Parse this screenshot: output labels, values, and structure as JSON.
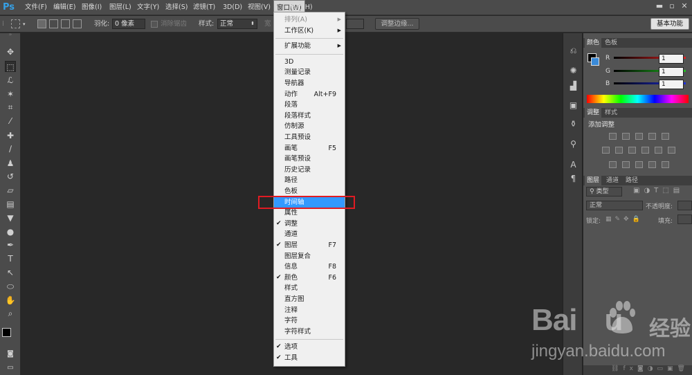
{
  "app": {
    "logo": "Ps"
  },
  "menubar": {
    "items": [
      "文件(F)",
      "编辑(E)",
      "图像(I)",
      "图层(L)",
      "文字(Y)",
      "选择(S)",
      "滤镜(T)",
      "3D(D)",
      "视图(V)",
      "窗口(W)",
      "帮助(H)"
    ],
    "active_index": 9
  },
  "options": {
    "feather_label": "羽化:",
    "feather_value": "0 像素",
    "antialias_label": "消除锯齿",
    "style_label": "样式:",
    "style_value": "正常",
    "width_label": "宽",
    "refine_edge": "调整边缘...",
    "workspace": "基本功能"
  },
  "toolbar": {
    "tools": [
      "move-icon",
      "rect-marquee-icon",
      "lasso-icon",
      "quick-select-icon",
      "crop-icon",
      "eyedropper-icon",
      "healing-brush-icon",
      "brush-icon",
      "clone-stamp-icon",
      "history-brush-icon",
      "eraser-icon",
      "gradient-icon",
      "blur-icon",
      "dodge-icon",
      "pen-icon",
      "type-icon",
      "path-select-icon",
      "ellipse-icon",
      "hand-icon",
      "zoom-icon"
    ],
    "type_glyph": "T"
  },
  "window_menu": {
    "items": [
      {
        "label": "排列(A)",
        "submenu": true,
        "disabled": true
      },
      {
        "label": "工作区(K)",
        "submenu": true
      },
      {
        "sep": true
      },
      {
        "label": "扩展功能",
        "submenu": true
      },
      {
        "sep": true
      },
      {
        "label": "3D"
      },
      {
        "label": "测量记录"
      },
      {
        "label": "导航器"
      },
      {
        "label": "动作",
        "shortcut": "Alt+F9"
      },
      {
        "label": "段落"
      },
      {
        "label": "段落样式"
      },
      {
        "label": "仿制源"
      },
      {
        "label": "工具预设"
      },
      {
        "label": "画笔",
        "shortcut": "F5"
      },
      {
        "label": "画笔预设"
      },
      {
        "label": "历史记录"
      },
      {
        "label": "路径"
      },
      {
        "label": "色板"
      },
      {
        "label": "时间轴",
        "highlighted": true
      },
      {
        "label": "属性"
      },
      {
        "label": "调整",
        "checked": true
      },
      {
        "label": "通道"
      },
      {
        "label": "图层",
        "shortcut": "F7",
        "checked": true
      },
      {
        "label": "图层复合"
      },
      {
        "label": "信息",
        "shortcut": "F8"
      },
      {
        "label": "颜色",
        "shortcut": "F6",
        "checked": true
      },
      {
        "label": "样式"
      },
      {
        "label": "直方图"
      },
      {
        "label": "注释"
      },
      {
        "label": "字符"
      },
      {
        "label": "字符样式"
      },
      {
        "sep": true
      },
      {
        "label": "选项",
        "checked": true
      },
      {
        "label": "工具",
        "checked": true
      }
    ]
  },
  "color_panel": {
    "tabs": [
      "颜色",
      "色板"
    ],
    "channels": [
      {
        "label": "R",
        "value": "1",
        "color": "#e02020"
      },
      {
        "label": "G",
        "value": "1",
        "color": "#20c020"
      },
      {
        "label": "B",
        "value": "1",
        "color": "#2030e0"
      }
    ]
  },
  "adjust_panel": {
    "tabs": [
      "调整",
      "样式"
    ],
    "title": "添加调整"
  },
  "layers_panel": {
    "tabs": [
      "图层",
      "通道",
      "路径"
    ],
    "filter": "类型",
    "blend": "正常",
    "opacity_label": "不透明度:",
    "lock_label": "锁定:",
    "fill_label": "填充:"
  },
  "strip_icons": [
    "history-icon",
    "info-icon",
    "histogram-icon",
    "brush-preset-icon",
    "clone-source-icon",
    "tool-preset-icon",
    "character-icon",
    "paragraph-icon"
  ],
  "watermark": {
    "logo": "Bai",
    "logo2": "u",
    "cn": "经验",
    "url": "jingyan.baidu.com"
  }
}
